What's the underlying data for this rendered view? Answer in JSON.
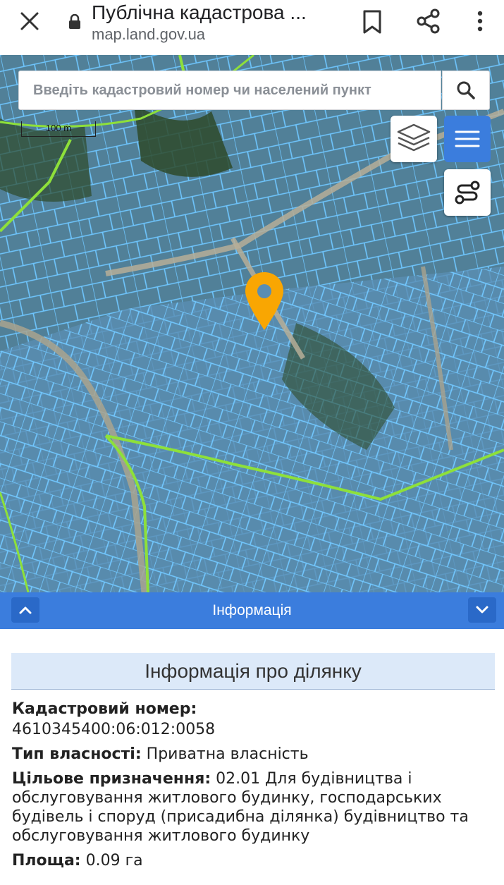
{
  "browser": {
    "title": "Публічна кадастрова ...",
    "url": "map.land.gov.ua"
  },
  "map": {
    "search_placeholder": "Введіть кадастровий номер чи населений пункт",
    "scale_label": "100 m",
    "colors": {
      "parcel_fill": "#5b8fb6",
      "parcel_stroke": "#6ec6ff",
      "boundary_line": "#8ee03a",
      "pin": "#f9a602",
      "accent": "#3b7ddd"
    }
  },
  "info_bar": {
    "label": "Інформація"
  },
  "parcel_info": {
    "header": "Інформація про ділянку",
    "cadastral_label": "Кадастровий номер:",
    "cadastral_value": "4610345400:06:012:0058",
    "ownership_label": "Тип власності:",
    "ownership_value": "Приватна власність",
    "purpose_label": "Цільове призначення:",
    "purpose_value": "02.01 Для будівництва і обслуговування житлового будинку, господарських будівель і споруд (присадибна ділянка) будівництво та обслуговування житлового будинку",
    "area_label": "Площа:",
    "area_value": "0.09 га"
  }
}
